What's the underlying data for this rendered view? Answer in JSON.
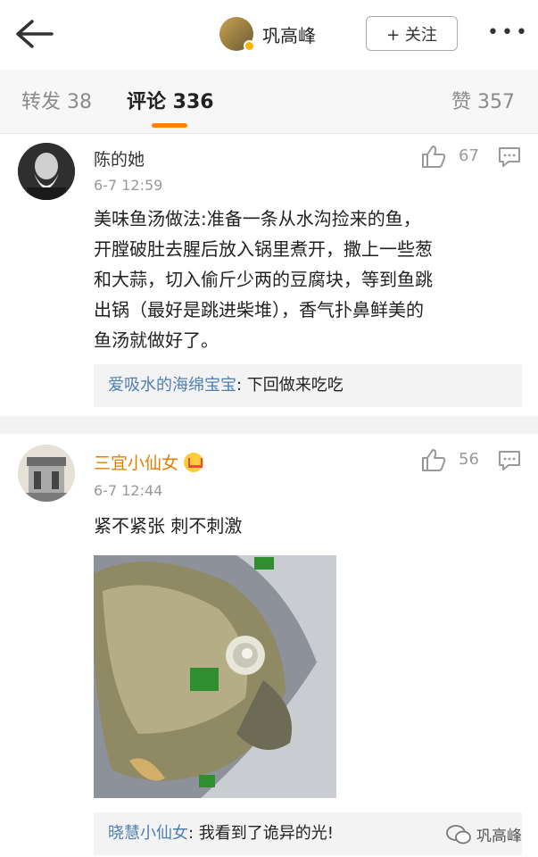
{
  "header": {
    "back_icon": "back-arrow-icon",
    "user_name": "巩高峰",
    "follow_label": "+ 关注",
    "more_icon": "more-dots-icon"
  },
  "tabs": {
    "repost": "转发 38",
    "comments": "评论 336",
    "likes": "赞 357",
    "accent": "#ff8200"
  },
  "comments": [
    {
      "name": "陈的她",
      "time": "6-7 12:59",
      "likes": "67",
      "text_lines": [
        "美味鱼汤做法:准备一条从水沟捡来的鱼，",
        "开膛破肚去腥后放入锅里煮开，撒上一些葱",
        "和大蒜，切入偷斤少两的豆腐块，等到鱼跳",
        "出锅（最好是跳进柴堆），香气扑鼻鲜美的",
        "鱼汤就做好了。"
      ],
      "reply_user": "爱吸水的海绵宝宝",
      "reply_text": ": 下回做来吃吃"
    },
    {
      "name": "三宜小仙女",
      "time": "6-7 12:44",
      "likes": "56",
      "text": "紧不紧张 刺不刺激",
      "reply_user": "晓慧小仙女",
      "reply_text": ": 我看到了诡异的光!"
    }
  ],
  "watermark": "巩高峰"
}
